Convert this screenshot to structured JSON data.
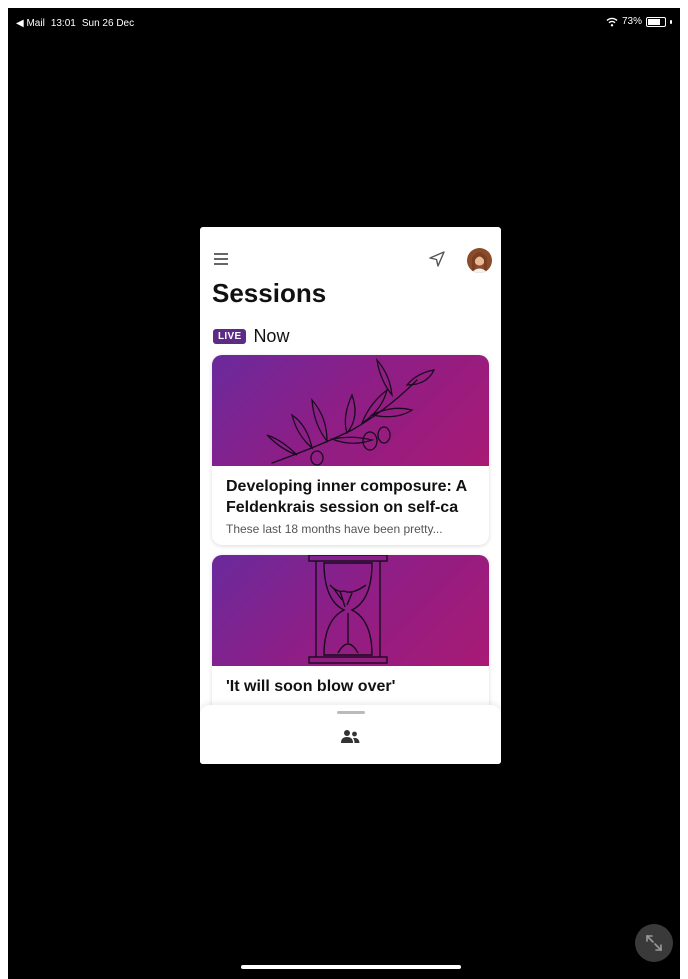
{
  "status_bar": {
    "back_label": "◀ Mail",
    "time": "13:01",
    "date": "Sun 26 Dec",
    "battery_percent": "73%",
    "battery_level": 0.73
  },
  "app": {
    "title": "Sessions",
    "live": {
      "badge": "LIVE",
      "label": "Now"
    },
    "sessions": [
      {
        "title": "Developing inner composure: A Feldenkrais session on self-ca",
        "description": "These last 18 months have been pretty...",
        "image_icon": "olive-branch-illustration"
      },
      {
        "title": "'It will soon blow over'",
        "description": "",
        "image_icon": "hourglass-illustration"
      }
    ],
    "bottom_nav": {
      "icon": "people-icon"
    }
  },
  "colors": {
    "live_badge": "#5d2a86",
    "card_gradient_start": "#6a2a9c",
    "card_gradient_end": "#a81a74"
  }
}
